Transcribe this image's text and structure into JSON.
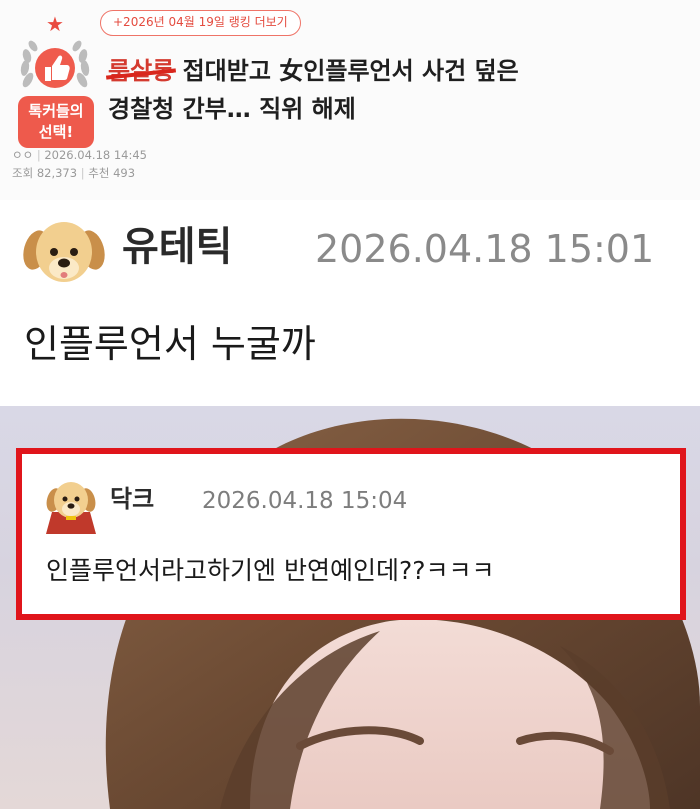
{
  "ranking_pill": "+2026년 04월 19일 랭킹 더보기",
  "badge": {
    "line1": "톡커들의",
    "line2": "선택!"
  },
  "post": {
    "title_struck": "룸살롱",
    "title_rest": " 접대받고 女인플루언서 사건 덮은",
    "title_line2": "경찰청 간부… 직위 해제",
    "author": "ㅇㅇ",
    "date": "2026.04.18 14:45",
    "views_label": "조회 82,373",
    "recommend_label": "추천 493"
  },
  "comment1": {
    "name": "유테틱",
    "timestamp": "2026.04.18 15:01",
    "text": "인플루언서 누굴까"
  },
  "comment2": {
    "name": "닥크",
    "timestamp": "2026.04.18 15:04",
    "text": "인플루언서라고하기엔 반연예인데??ㅋㅋㅋ"
  },
  "colors": {
    "accent_red": "#e0151b",
    "badge_red": "#ee5a4c",
    "timestamp_gray": "#8a8a8a"
  },
  "icons": {
    "badge": "thumbs-up-wreath-icon",
    "avatar1": "puppy-avatar-icon",
    "avatar2": "puppy-cape-avatar-icon"
  }
}
